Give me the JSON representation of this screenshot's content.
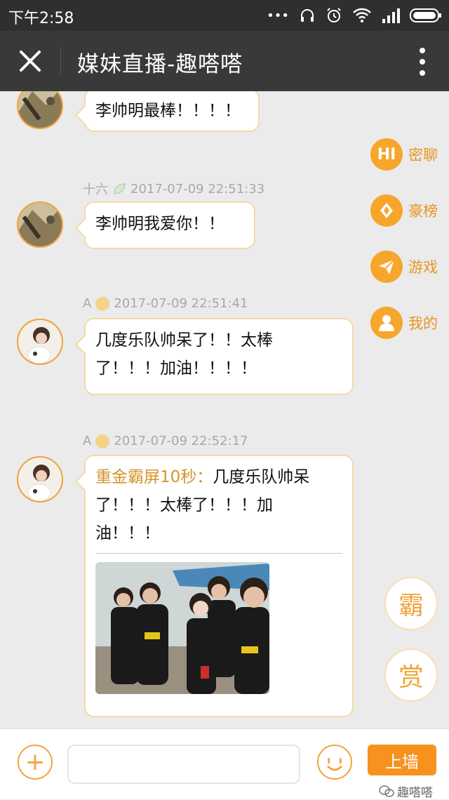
{
  "status_bar": {
    "time": "下午2:58",
    "dots": "•••"
  },
  "app_bar": {
    "title": "媒妹直播-趣嗒嗒"
  },
  "messages": [
    {
      "text": "李帅明最棒！！！！"
    },
    {
      "user": "十六",
      "timestamp": "2017-07-09 22:51:33",
      "text": "李帅明我爱你！！"
    },
    {
      "user": "A",
      "timestamp": "2017-07-09 22:51:41",
      "text_line1": "几度乐队帅呆了！！太棒",
      "text_line2": "了！！！加油！！！！"
    },
    {
      "user": "A",
      "timestamp": "2017-07-09 22:52:17",
      "tag": "重金霸屏10秒：",
      "text_part1": "几度乐队帅呆",
      "text_line2": "了！！！太棒了！！！加",
      "text_line3": "油！！！"
    }
  ],
  "side_menu": [
    {
      "icon": "hi-icon",
      "icon_text": "HI",
      "label": "密聊"
    },
    {
      "icon": "trophy-icon",
      "label": "豪榜"
    },
    {
      "icon": "paper-plane-icon",
      "label": "游戏"
    },
    {
      "icon": "person-icon",
      "label": "我的"
    }
  ],
  "float_buttons": {
    "ba": "霸",
    "shang": "赏"
  },
  "bottom_bar": {
    "input_value": "",
    "post_label": "上墙",
    "plus": "+"
  },
  "watermark": "趣嗒嗒",
  "colors": {
    "accent": "#f7921e",
    "gold_text": "#d4942a",
    "bubble_border": "#f3d9a7"
  }
}
